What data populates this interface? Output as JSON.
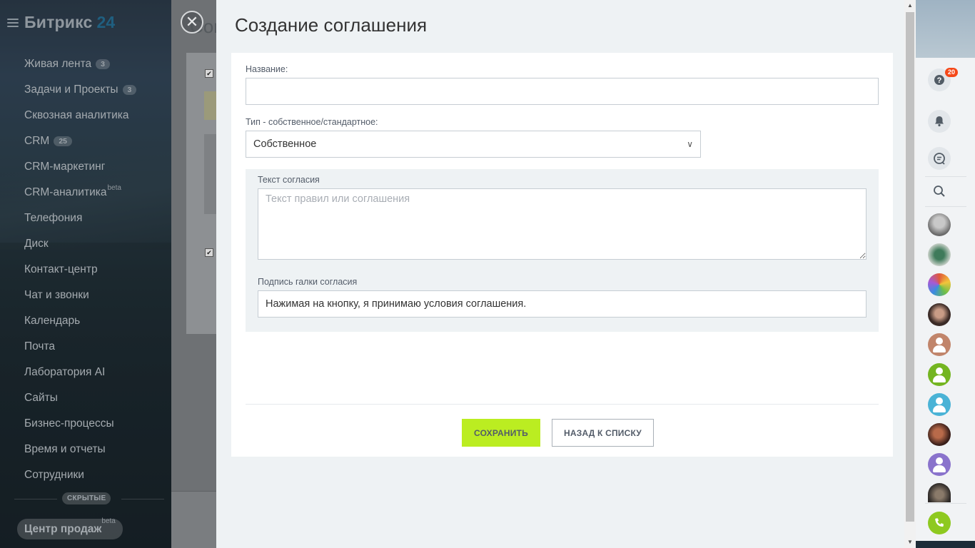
{
  "sidebar": {
    "brand_name": "Битрикс",
    "brand_number": "24",
    "items": [
      {
        "label": "Живая лента",
        "count": "3"
      },
      {
        "label": "Задачи и Проекты",
        "count": "3"
      },
      {
        "label": "Сквозная аналитика"
      },
      {
        "label": "CRM",
        "count": "25"
      },
      {
        "label": "CRM-маркетинг"
      },
      {
        "label": "CRM-аналитика",
        "sup": "beta"
      },
      {
        "label": "Телефония"
      },
      {
        "label": "Диск"
      },
      {
        "label": "Контакт-центр"
      },
      {
        "label": "Чат и звонки"
      },
      {
        "label": "Календарь"
      },
      {
        "label": "Почта"
      },
      {
        "label": "Лаборатория AI"
      },
      {
        "label": "Сайты"
      },
      {
        "label": "Бизнес-процессы"
      },
      {
        "label": "Время и отчеты"
      },
      {
        "label": "Сотрудники"
      }
    ],
    "hidden_label": "СКРЫТЫЕ",
    "sales_center": "Центр продаж",
    "sales_center_sup": "beta"
  },
  "background_page": {
    "title_fragment": "Сог"
  },
  "slider": {
    "title": "Создание соглашения",
    "name_label": "Название:",
    "name_value": "",
    "type_label": "Тип - собственное/стандартное:",
    "type_value": "Собственное",
    "consent_text_label": "Текст согласия",
    "consent_text_placeholder": "Текст правил или соглашения",
    "checkbox_caption_label": "Подпись галки согласия",
    "checkbox_caption_value": "Нажимая на кнопку, я принимаю условия соглашения.",
    "save_button": "СОХРАНИТЬ",
    "back_button": "НАЗАД К СПИСКУ"
  },
  "right_panel": {
    "notification_badge": "20"
  },
  "colors": {
    "save_button": "#bbed21",
    "badge": "#f54819",
    "call_button": "#8ec920"
  }
}
